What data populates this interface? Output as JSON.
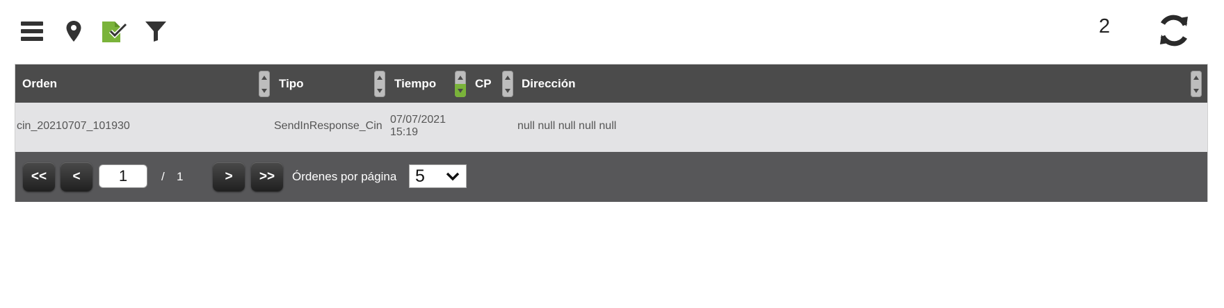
{
  "toolbar": {
    "icons": [
      "menu-icon",
      "map-pin-icon",
      "checked-document-icon",
      "filter-icon"
    ],
    "count": "2",
    "refresh_icon": "refresh-icon"
  },
  "colors": {
    "accent": "#7ab33a",
    "header_bg": "#4b4b4b",
    "pager_bg": "#575759",
    "row_bg": "#e3e3e5"
  },
  "grid": {
    "columns": [
      "Orden",
      "Tipo",
      "Tiempo",
      "CP",
      "Dirección"
    ],
    "rows": [
      {
        "orden": "cin_20210707_101930",
        "tipo": "SendInResponse_Cin",
        "tiempo_date": "07/07/2021",
        "tiempo_time": "15:19",
        "cp": "",
        "direccion": "null null null null null"
      }
    ]
  },
  "pager": {
    "first": "<<",
    "prev": "<",
    "page": "1",
    "separator": "/",
    "total": "1",
    "next": ">",
    "last": ">>",
    "per_page_label": "Órdenes por página",
    "per_page": "5"
  }
}
